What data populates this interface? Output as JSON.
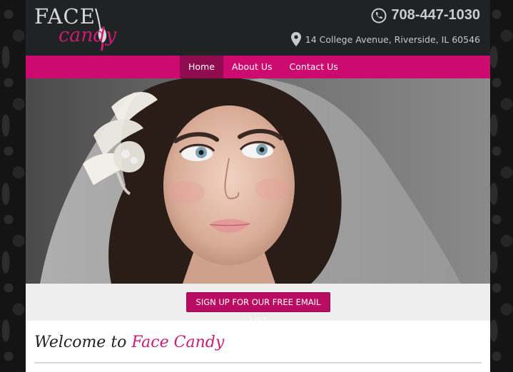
{
  "brand": {
    "logo_top": "FACE",
    "logo_bottom": "candy",
    "accent_color": "#cc0a6f"
  },
  "contact": {
    "phone": "708-447-1030",
    "address": "14 College Avenue, Riverside, IL 60546"
  },
  "nav": {
    "items": [
      {
        "label": "Home"
      },
      {
        "label": "About Us"
      },
      {
        "label": "Contact Us"
      }
    ]
  },
  "hero": {
    "image": "bride-portrait"
  },
  "cta": {
    "label": "SIGN UP FOR OUR FREE EMAIL LIST"
  },
  "welcome": {
    "prefix": "Welcome to",
    "brand": "Face Candy"
  }
}
